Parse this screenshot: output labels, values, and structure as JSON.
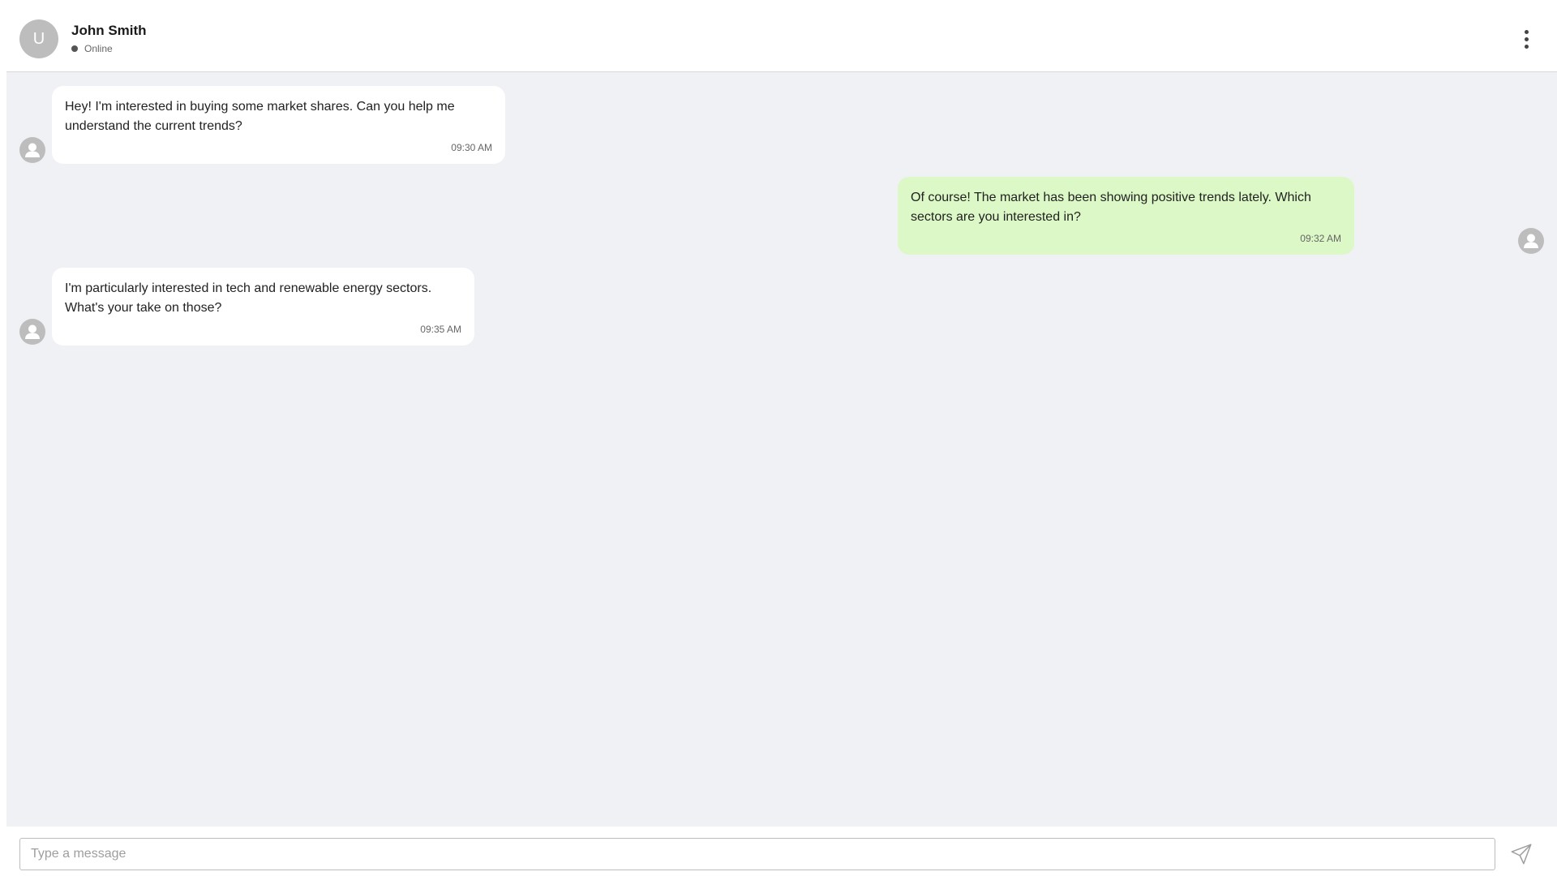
{
  "header": {
    "avatar_initial": "U",
    "name": "John Smith",
    "status": "Online",
    "status_color": "#555555"
  },
  "messages": [
    {
      "direction": "in",
      "text": "Hey! I'm interested in buying some market shares. Can you help me understand the current trends?",
      "time": "09:30 AM"
    },
    {
      "direction": "out",
      "text": "Of course! The market has been showing positive trends lately. Which sectors are you interested in?",
      "time": "09:32 AM"
    },
    {
      "direction": "in",
      "text": "I'm particularly interested in tech and renewable energy sectors. What's your take on those?",
      "time": "09:35 AM"
    }
  ],
  "composer": {
    "placeholder": "Type a message",
    "value": ""
  },
  "icons": {
    "menu": "more-vertical-icon",
    "send": "send-icon",
    "avatar": "person-icon"
  },
  "colors": {
    "incoming_bubble": "#ffffff",
    "outgoing_bubble": "#dcf8c6",
    "chat_background": "#f0f1f5"
  }
}
